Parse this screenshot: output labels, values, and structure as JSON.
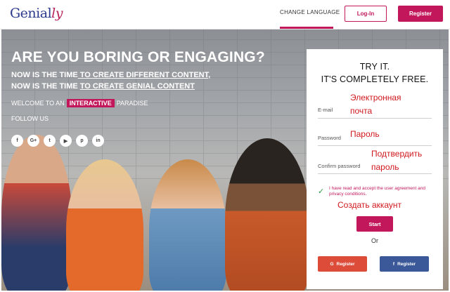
{
  "header": {
    "logo_main": "Genial",
    "logo_accent": "ly",
    "change_language": "CHANGE LANGUAGE",
    "login": "Log-In",
    "register": "Register"
  },
  "hero": {
    "title": "ARE YOU BORING OR ENGAGING?",
    "line1_prefix": "NOW IS THE TIME",
    "line1_link": " TO CREATE DIFFERENT CONTENT,",
    "line2_prefix": "NOW IS THE TIME ",
    "line2_link": "TO CREATE GENIAL CONTENT",
    "welcome_prefix": "WELCOME TO AN",
    "welcome_tag": "INTERACTIVE",
    "welcome_suffix": "PARADISE",
    "follow": "FOLLOW US",
    "socials": [
      {
        "icon": "facebook-icon",
        "glyph": "f"
      },
      {
        "icon": "google-plus-icon",
        "glyph": "G+"
      },
      {
        "icon": "twitter-icon",
        "glyph": "t"
      },
      {
        "icon": "youtube-icon",
        "glyph": "▶"
      },
      {
        "icon": "pinterest-icon",
        "glyph": "p"
      },
      {
        "icon": "linkedin-icon",
        "glyph": "in"
      }
    ]
  },
  "form": {
    "title_line1": "TRY IT.",
    "title_line2": "IT'S COMPLETELY FREE.",
    "email_label": "E-mail",
    "email_annotation_1": "Электронная",
    "email_annotation_2": "почта",
    "password_label": "Password",
    "password_annotation": "Пароль",
    "confirm_label": "Confirm password",
    "confirm_annotation_1": "Подтвердить",
    "confirm_annotation_2": "пароль",
    "agree_text": "I have read and accept the user agreement and privacy conditions.",
    "create_account_annotation": "Создать аккаунт",
    "start": "Start",
    "or": "Or",
    "google_register": "Register",
    "google_glyph": "G",
    "facebook_register": "Register",
    "facebook_glyph": "f"
  },
  "colors": {
    "accent": "#c2185b",
    "annotation": "#d0181e",
    "google": "#dd4b39",
    "facebook": "#3b5998"
  }
}
